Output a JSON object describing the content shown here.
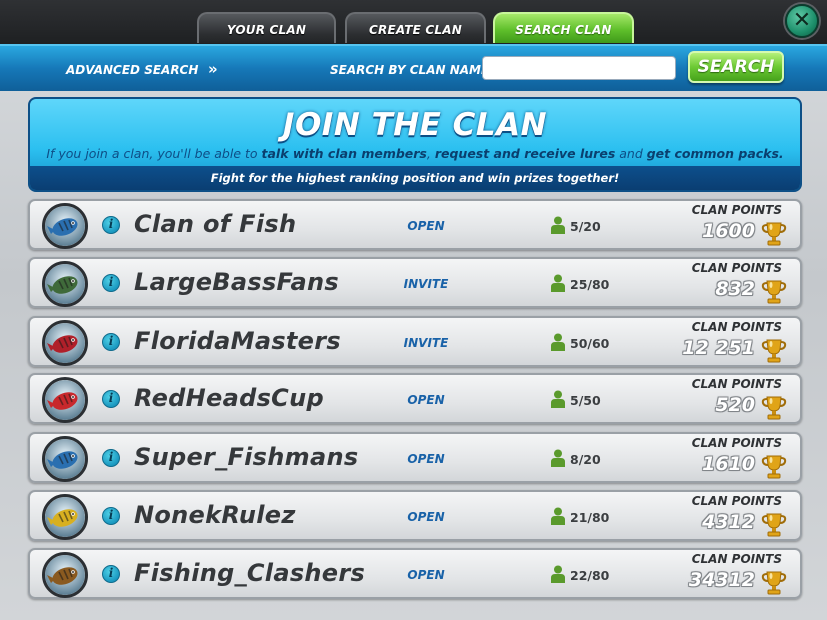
{
  "tabs": [
    {
      "label": "YOUR CLAN",
      "active": false
    },
    {
      "label": "CREATE CLAN",
      "active": false
    },
    {
      "label": "SEARCH CLAN",
      "active": true
    }
  ],
  "close_icon": "close-icon",
  "search_bar": {
    "advanced_label": "ADVANCED SEARCH",
    "advanced_arrows": "»",
    "name_label": "SEARCH BY CLAN NAME:",
    "name_value": "",
    "button_label": "SEARCH"
  },
  "banner": {
    "title": "JOIN THE CLAN",
    "text_1": "If you join a clan, you'll be able to ",
    "bold_1": "talk with clan members",
    "text_2": ", ",
    "bold_2": "request and receive lures",
    "text_3": " and ",
    "bold_3": "get common packs.",
    "footer": "Fight for the highest ranking position and win prizes together!"
  },
  "points_label": "CLAN POINTS",
  "clans": [
    {
      "name": "Clan of Fish",
      "status": "OPEN",
      "members": "5/20",
      "points": "1600",
      "avatar": "striped-fish",
      "color": "#2a6fb0"
    },
    {
      "name": "LargeBassFans",
      "status": "INVITE",
      "members": "25/80",
      "points": "832",
      "avatar": "pike-fish",
      "color": "#3f6a3a"
    },
    {
      "name": "FloridaMasters",
      "status": "INVITE",
      "members": "50/60",
      "points": "12 251",
      "avatar": "red-fish",
      "color": "#b0202a"
    },
    {
      "name": "RedHeadsCup",
      "status": "OPEN",
      "members": "5/50",
      "points": "520",
      "avatar": "redhead-fish",
      "color": "#c8282c"
    },
    {
      "name": "Super_Fishmans",
      "status": "OPEN",
      "members": "8/20",
      "points": "1610",
      "avatar": "striped-fish",
      "color": "#2a6fb0"
    },
    {
      "name": "NonekRulez",
      "status": "OPEN",
      "members": "21/80",
      "points": "4312",
      "avatar": "golden-fish",
      "color": "#d8b020"
    },
    {
      "name": "Fishing_Clashers",
      "status": "OPEN",
      "members": "22/80",
      "points": "34312",
      "avatar": "bass-fish",
      "color": "#8a5a20"
    }
  ],
  "colors": {
    "accent_green": "#6cc934",
    "accent_blue": "#1678b8",
    "status_blue": "#1962a8",
    "member_green": "#5a9a2c",
    "trophy_gold": "#e0a418"
  }
}
